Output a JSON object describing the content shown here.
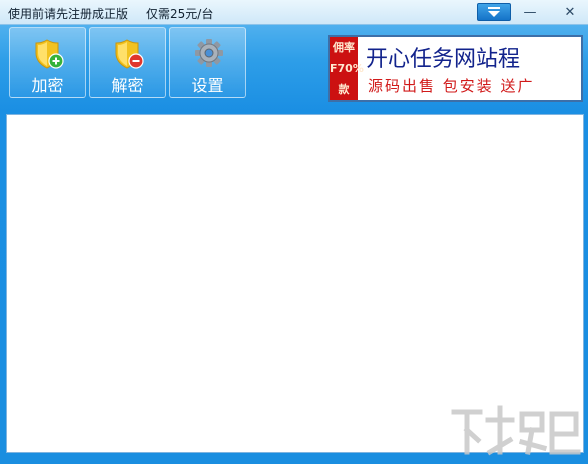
{
  "titlebar": {
    "title": "使用前请先注册成正版",
    "price_note": "仅需25元/台",
    "minimize_glyph": "—",
    "close_glyph": "✕"
  },
  "toolbar": {
    "encrypt_label": "加密",
    "decrypt_label": "解密",
    "settings_label": "设置"
  },
  "ad": {
    "side_text_1": "佣率",
    "side_text_2": "F70%",
    "side_text_3": "款",
    "headline": "开心任务网站程",
    "tagline": "源码出售 包安装 送广"
  },
  "colors": {
    "accent_blue": "#1a8ee0",
    "ad_red": "#cc1111",
    "ad_navy": "#12238c"
  },
  "icons": {
    "encrypt": "shield-plus-icon",
    "decrypt": "shield-minus-icon",
    "settings": "gear-icon",
    "menu": "dropdown-menu-icon"
  }
}
